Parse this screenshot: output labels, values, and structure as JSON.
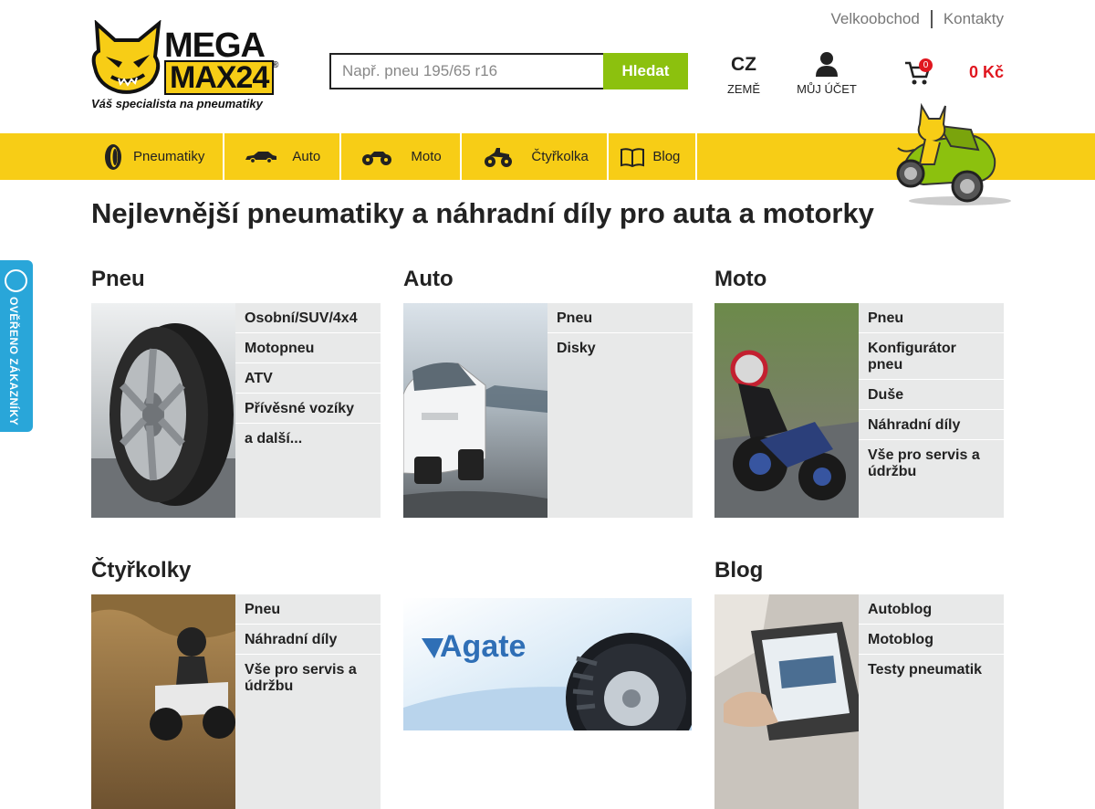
{
  "brand": {
    "line1": "MEGA",
    "line2": "MAX24",
    "reg": "®",
    "tagline": "Váš specialista na pneumatiky"
  },
  "toplinks": {
    "wholesale": "Velkoobchod",
    "contacts": "Kontakty"
  },
  "search": {
    "placeholder": "Např. pneu 195/65 r16",
    "button": "Hledat"
  },
  "country": {
    "code": "CZ",
    "label": "ZEMĚ"
  },
  "account": {
    "label": "MŮJ ÚČET"
  },
  "cart": {
    "count": "0",
    "total": "0 Kč"
  },
  "nav": [
    {
      "label": "Pneumatiky",
      "icon": "tire-icon"
    },
    {
      "label": "Auto",
      "icon": "car-icon"
    },
    {
      "label": "Moto",
      "icon": "motorcycle-icon"
    },
    {
      "label": "Čtyřkolka",
      "icon": "atv-icon"
    },
    {
      "label": "Blog",
      "icon": "book-icon"
    }
  ],
  "headline": "Nejlevnější pneumatiky a náhradní díly pro auta a motorky",
  "sections": [
    {
      "title": "Pneu",
      "links": [
        "Osobní/SUV/4x4",
        "Motopneu",
        "ATV",
        "Přívěsné vozíky",
        "a další..."
      ]
    },
    {
      "title": "Auto",
      "links": [
        "Pneu",
        "Disky"
      ]
    },
    {
      "title": "Moto",
      "links": [
        "Pneu",
        "Konfigurátor pneu",
        "Duše",
        "Náhradní díly",
        "Vše pro servis a údržbu"
      ]
    },
    {
      "title": "Čtyřkolky",
      "links": [
        "Pneu",
        "Náhradní díly",
        "Vše pro servis a údržbu"
      ]
    },
    {
      "title": "",
      "links": []
    },
    {
      "title": "Blog",
      "links": [
        "Autoblog",
        "Motoblog",
        "Testy pneumatik"
      ]
    }
  ],
  "banner": {
    "text": "Agate"
  },
  "side_badge": {
    "text": "OVĚŘENO ZÁKAZNÍKY"
  },
  "colors": {
    "accent_yellow": "#f7cd16",
    "search_green": "#8cc10e",
    "price_red": "#e0161f",
    "badge_blue": "#29a6d9"
  }
}
